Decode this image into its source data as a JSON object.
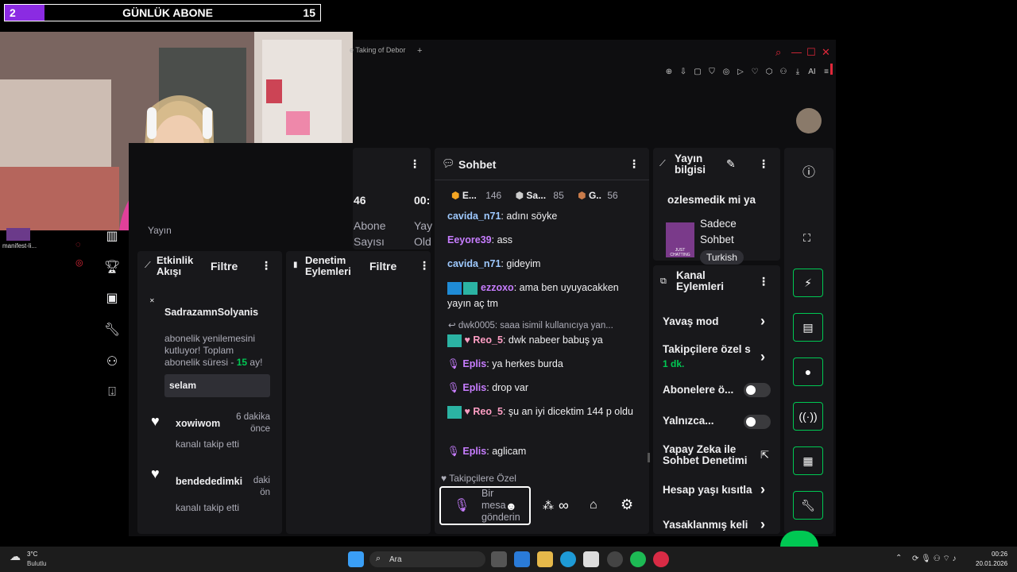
{
  "overlay": {
    "count": "2",
    "label": "GÜNLÜK ABONE",
    "goal": "15"
  },
  "browser": {
    "tab_title": "e Taking of Debor",
    "new_tab": "+",
    "ai_label": "AI"
  },
  "desktop": {
    "shortcut": "manifest-li..."
  },
  "stream_stats": {
    "viewers": "46",
    "time": "00:",
    "label1a": "Abone",
    "label1b": "Sayısı",
    "label2a": "Yay",
    "label2b": "Old",
    "label0": "Yayın"
  },
  "activity": {
    "title1": "Etkinlik",
    "title2": "Akışı",
    "filter": "Filtre",
    "items": [
      {
        "user": "SadrazamnSolyanis",
        "text": "abonelik yenilemesini kutluyor! Toplam abonelik süresi - ",
        "months": "15",
        "months_suffix": " ay!",
        "message": "selam"
      },
      {
        "user": "xowiwom",
        "time1": "6 dakika",
        "time2": "önce",
        "text": "kanalı takip etti"
      },
      {
        "user": "bendededimki",
        "time1": "daki",
        "time2": "ön",
        "text": "kanalı takip etti"
      }
    ]
  },
  "mod_actions": {
    "title1": "Denetim",
    "title2": "Eylemleri",
    "filter": "Filtre"
  },
  "chat": {
    "title": "Sohbet",
    "leaders": [
      {
        "name": "E...",
        "score": "146"
      },
      {
        "name": "Sa...",
        "score": "85"
      },
      {
        "name": "G..",
        "score": "56"
      }
    ],
    "messages": [
      {
        "user": "cavida_n71",
        "text": "adını söyke",
        "color": "#9ec9ff"
      },
      {
        "user": "Eeyore39",
        "text": "ass",
        "color": "#c77dff"
      },
      {
        "user": "cavida_n71",
        "text": "gideyim",
        "color": "#9ec9ff"
      },
      {
        "user": "ezzoxo",
        "text": "ama ben uyuyacakken yayın aç tm",
        "color": "#c77dff"
      },
      {
        "reply": "dwk0005: saaa isimil kullanıcıya yan..."
      },
      {
        "user": "Reo_5",
        "text": "dwk nabeer babuş ya",
        "color": "#ff9ec4"
      },
      {
        "user": "Eplis",
        "text": "ya herkes burda",
        "color": "#c77dff"
      },
      {
        "user": "Eplis",
        "text": "drop var",
        "color": "#c77dff"
      },
      {
        "user": "Reo_5",
        "text": "şu an iyi dicektim 144 p oldu",
        "color": "#ff9ec4"
      },
      {
        "user": "Eplis",
        "text": "aglicam",
        "color": "#c77dff"
      }
    ],
    "followers_only": "Takipçilere Özel",
    "input_placeholder": "Bir mesaj gönderin",
    "input_visible": "Bir\nmesa\ngönderin"
  },
  "stream_info": {
    "title1": "Yayın",
    "title2": "bilgisi",
    "stream_title": "ozlesmedik mi ya",
    "category1": "Sadece",
    "category2": "Sohbet",
    "tag": "Turkish",
    "thumb": "JUST CHATTING"
  },
  "channel_actions": {
    "title1": "Kanal",
    "title2": "Eylemleri",
    "slow_mode": "Yavaş mod",
    "followers_only": "Takipçilere özel s",
    "followers_duration": "1 dk.",
    "subs_only": "Abonelere ö...",
    "unique": "Yalnızca...",
    "ai_mod1": "Yapay Zeka ile",
    "ai_mod2": "Sohbet Denetimi",
    "account_age": "Hesap yaşı kısıtla",
    "banned": "Yasaklanmış keli"
  },
  "taskbar": {
    "weather_temp": "3°C",
    "weather_desc": "Bulutlu",
    "search": "Ara",
    "time": "00:26",
    "date": "20.01.2026"
  },
  "colors": {
    "accent": "#8b2be2",
    "green": "#00c853",
    "bg": "#0e0e10",
    "panel": "#18181b"
  }
}
